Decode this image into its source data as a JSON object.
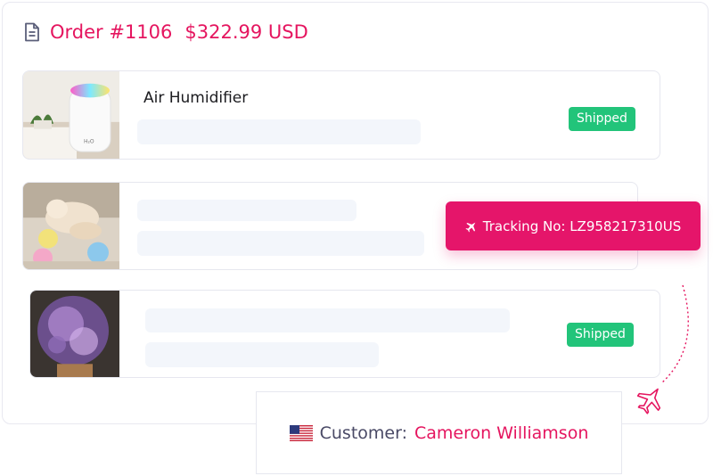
{
  "order": {
    "number": "Order #1106",
    "total": "$322.99 USD",
    "icon": "document-icon"
  },
  "items": [
    {
      "name": "Air Humidifier",
      "status": "Shipped",
      "image": "humidifier-image"
    },
    {
      "name": "",
      "status": "",
      "image": "cat-toy-image"
    },
    {
      "name": "",
      "status": "Shipped",
      "image": "galaxy-lamp-image"
    }
  ],
  "tracking": {
    "label": "Tracking No: LZ958217310US",
    "icon": "airplane-icon"
  },
  "customer": {
    "label": "Customer:",
    "name": "Cameron Williamson",
    "flag": "us-flag-icon"
  },
  "colors": {
    "accent": "#e5155f",
    "shipped": "#22c47a",
    "skeleton": "#f3f6fb",
    "border": "#e6e7ef"
  }
}
